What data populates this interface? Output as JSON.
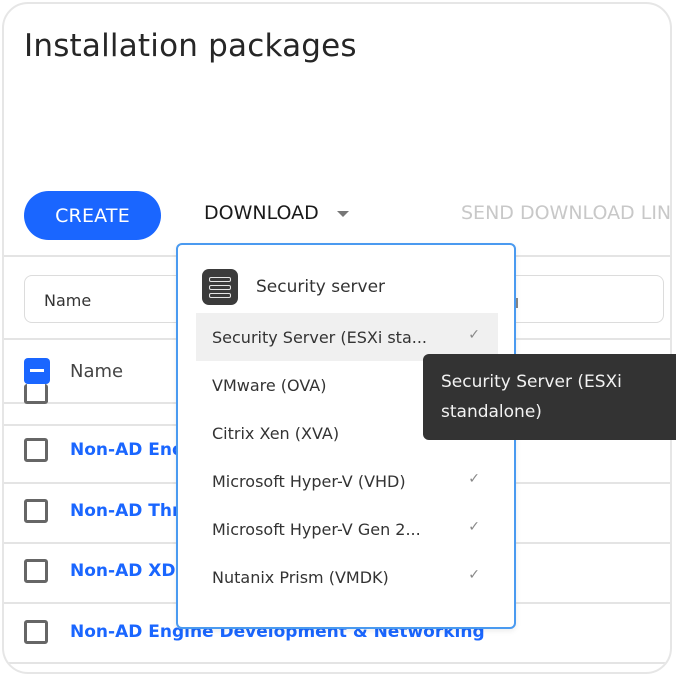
{
  "page": {
    "title": "Installation packages"
  },
  "toolbar": {
    "create_label": "CREATE",
    "download_label": "DOWNLOAD",
    "send_label": "SEND DOWNLOAD LINKS"
  },
  "filter": {
    "label": "Name"
  },
  "table": {
    "column_header": "Name",
    "rows": [
      {
        "name": "Non-AD Endpoint"
      },
      {
        "name": "Non-AD Threat"
      },
      {
        "name": "Non-AD XDR"
      },
      {
        "name": "Non-AD Engine Development & Networking"
      }
    ]
  },
  "dropdown": {
    "group_label": "Security server",
    "group_icon": "server-icon",
    "items": [
      {
        "label": "Security Server (ESXi sta...",
        "checked": true,
        "hovered": true
      },
      {
        "label": "VMware (OVA)",
        "checked": false
      },
      {
        "label": "Citrix Xen (XVA)",
        "checked": false
      },
      {
        "label": "Microsoft Hyper-V (VHD)",
        "checked": true
      },
      {
        "label": "Microsoft Hyper-V Gen 2...",
        "checked": true
      },
      {
        "label": "Nutanix Prism (VMDK)",
        "checked": true
      }
    ],
    "check_glyph": "✓"
  },
  "tooltip": {
    "text_line1": "Security Server (ESXi",
    "text_line2": "standalone)"
  },
  "colors": {
    "accent": "#1a66ff",
    "dropdown_border": "#4a9af0",
    "tooltip_bg": "#333333"
  }
}
